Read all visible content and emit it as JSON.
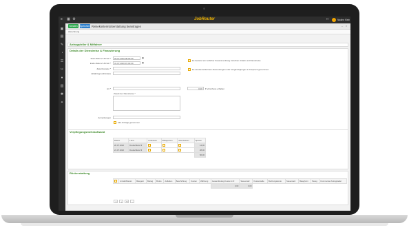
{
  "app": {
    "brand": "JobRouter",
    "user": "Nadine Klein"
  },
  "toolbar": {
    "btn_send": "Senden",
    "btn_save": "Speichern",
    "title": "Reisekostenrückerstattung beantragen",
    "subtab": "Abrechnung"
  },
  "sections": {
    "applicant": "Antragsteller & Mitfahrer",
    "trip": "Details der Dienstreise & Finanzierung",
    "meals": "Verpflegungsmehraufwand",
    "refund": "Rückerstattung"
  },
  "trip": {
    "start_label": "Start-Datum/-Uhrzeit *",
    "start_value": "20.07.2020 08:00:00",
    "end_label": "Ende-Datum/-Uhrzeit *",
    "end_value": "31.07.2020 15:00:00",
    "destination_label": "Zielort/Länder *",
    "purpose_label": "Abfahrtsgrund/Anlass",
    "opt1": "Es bestand ein zeitlicher Zusammenhang zwischen Urlaub und Dienstreise",
    "opt2": "Es wurden Entfernten Zuwendungen oder Vergünstigungen in Anspruch genommen",
    "art_label": "Art *",
    "amount_value": "0,00",
    "amount_suffix": "€ Vorschuss erhalten",
    "reason_label": "Zweck der Dienstreise *",
    "remarks_label": "Anmerkungen",
    "attach_label": "Alle Anträge genommen"
  },
  "meals_table": {
    "headers": [
      "Datum",
      "Land",
      "Frühstück",
      "Mittagessen",
      "Abendessen",
      "Spesen"
    ],
    "rows": [
      {
        "date": "20.07.2020",
        "country": "Deutschland",
        "spesen": "14,00"
      },
      {
        "date": "21.07.2020",
        "country": "Deutschland",
        "spesen": "28,00"
      }
    ],
    "total": "56,00"
  },
  "refund_table": {
    "headers": [
      "Anzahl/Datum",
      "Belegart",
      "Betrag",
      "Brutto",
      "Aufteilen",
      "Beschriftung",
      "Kosten",
      "Währung",
      "Gesamtbetrag Kosten in €",
      "Steuersatz",
      "Kostenstelle",
      "Buchungskonto",
      "Steuersatz",
      "Belegform",
      "Beleg",
      "Kommentar Antragsteller"
    ],
    "total1": "0,00",
    "total2": "0,00",
    "pager": [
      "1",
      "+",
      "↻"
    ]
  },
  "colors": {
    "accent": "#3e8a2a",
    "brand": "#f0b400",
    "send": "#2fa84f",
    "save": "#2c7fcc"
  },
  "icons": {
    "sidebar": [
      "menu-icon",
      "home-icon",
      "inbox-icon",
      "process-icon",
      "dashboard-icon",
      "archive-icon",
      "tools-icon",
      "user-icon",
      "document-icon",
      "link-icon"
    ]
  }
}
